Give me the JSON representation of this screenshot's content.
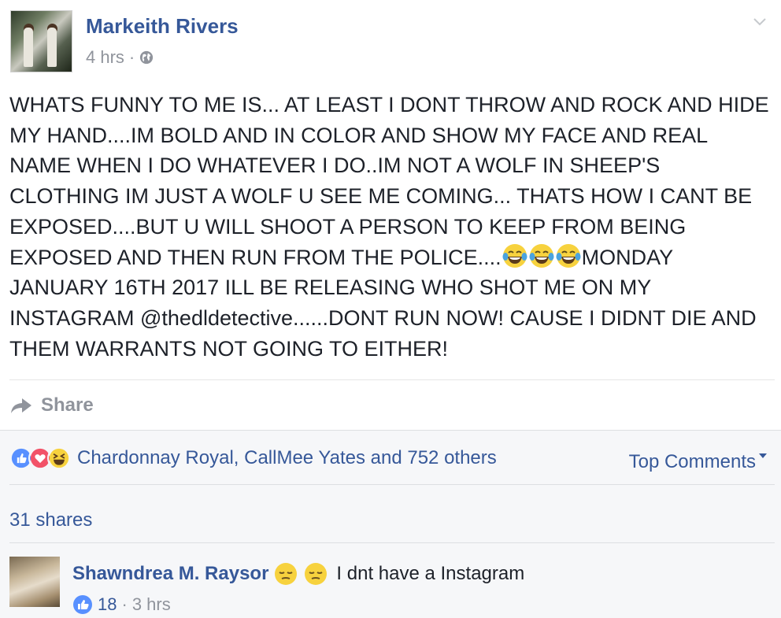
{
  "post": {
    "author": "Markeith Rivers",
    "time": "4 hrs",
    "meta_sep": "·",
    "privacy_icon": "globe-icon",
    "text_part1": "WHATS FUNNY TO ME IS... AT LEAST I DONT THROW AND ROCK AND HIDE MY HAND....IM BOLD AND IN COLOR AND SHOW MY FACE AND REAL NAME WHEN I DO WHATEVER I DO..IM NOT A WOLF IN SHEEP'S CLOTHING IM JUST A WOLF U SEE ME COMING... THATS HOW I CANT BE EXPOSED....BUT U WILL SHOOT A PERSON TO KEEP FROM BEING EXPOSED AND THEN RUN FROM THE POLICE....",
    "text_part2": "MONDAY JANUARY 16TH 2017 ILL BE RELEASING WHO SHOT ME ON MY INSTAGRAM @thedldetective......DONT RUN NOW! CAUSE I DIDNT DIE AND THEM WARRANTS NOT GOING TO EITHER!",
    "emoji_count": 3,
    "emoji": "laughing-tears-emoji"
  },
  "actions": {
    "share_label": "Share"
  },
  "feedback": {
    "reactions": [
      "like",
      "love",
      "haha"
    ],
    "reaction_names": "Chardonnay Royal, CallMee Yates and 752 others",
    "top_comments_label": "Top Comments",
    "shares_label": "31 shares"
  },
  "comment": {
    "author": "Shawndrea M. Raysor",
    "emoji": "pensive-emoji",
    "emoji_count": 2,
    "text": "I dnt have a Instagram",
    "likes": "18",
    "meta_sep": "·",
    "time": "3 hrs"
  },
  "colors": {
    "link": "#365899",
    "meta": "#90949c",
    "text": "#1d2129",
    "feedback_bg": "#f6f7f9",
    "like_blue": "#5890ff",
    "love_red": "#f25268",
    "haha_yellow": "#f7d23e"
  }
}
